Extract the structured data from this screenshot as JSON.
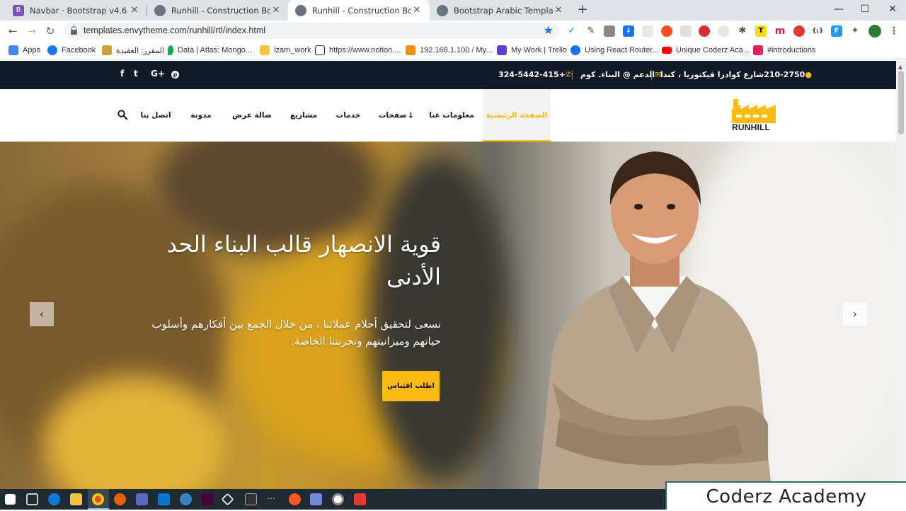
{
  "browser": {
    "tabs": [
      {
        "title": "Navbar · Bootstrap v4.6",
        "icon": "bootstrap-icon",
        "active": false
      },
      {
        "title": "Runhill - Construction Bootstrap",
        "icon": "globe-icon",
        "active": false
      },
      {
        "title": "Runhill - Construction Bootstrap",
        "icon": "globe-icon",
        "active": true
      },
      {
        "title": "Bootstrap Arabic Template",
        "icon": "globe-icon",
        "active": false
      }
    ],
    "new_tab": "+",
    "window_controls": {
      "minimize": "—",
      "maximize": "☐",
      "close": "✕"
    },
    "address": {
      "url": "templates.envytheme.com/runhill/rtl/index.html"
    },
    "bookmarks": [
      {
        "label": "Apps",
        "color": "#4285f4"
      },
      {
        "label": "Facebook",
        "color": "#1877f2"
      },
      {
        "label": "المقرر: العقيدة",
        "color": "#c9a13a"
      },
      {
        "label": "Data | Atlas: Mongo...",
        "color": "#13aa52"
      },
      {
        "label": "izam_work",
        "color": "#f5c542"
      },
      {
        "label": "https://www.notion....",
        "color": "#222222"
      },
      {
        "label": "192.168.1.100 / My...",
        "color": "#f29111"
      },
      {
        "label": "My Work | Trello",
        "color": "#5d3fd3"
      },
      {
        "label": "Using React Router...",
        "color": "#1a73e8"
      },
      {
        "label": "Unique Coderz Aca...",
        "color": "#ff0000"
      },
      {
        "label": "#introductions",
        "color": "#e01e5a"
      }
    ]
  },
  "site": {
    "topbar": {
      "address": "210-2750شارع كوادرا فيكتوريا ، كندا",
      "email": "الدعم @ البناء. كوم",
      "phone": "+324-5442-415",
      "social": [
        "f",
        "t",
        "G+",
        "p"
      ]
    },
    "logo": {
      "text": "RUNHILL"
    },
    "menu": [
      {
        "label": "الصفحة الرئيسية",
        "active": true
      },
      {
        "label": "معلومات عنا",
        "active": false
      },
      {
        "label": "صفحات ⭣",
        "active": false
      },
      {
        "label": "خدمات",
        "active": false
      },
      {
        "label": "مشاريع",
        "active": false
      },
      {
        "label": "صالة عرض",
        "active": false
      },
      {
        "label": "مدونة",
        "active": false
      },
      {
        "label": "اتصل بنا",
        "active": false
      }
    ],
    "hero": {
      "title": "قوية الانصهار قالب البناء الحد الأدنى",
      "subtitle": "نسعى لتحقيق أحلام عملائنا ، من خلال الجمع بين أفكارهم وأسلوب حياتهم وميزانيتهم وتجربتنا الخاصة.",
      "button": "اطلب اقتباس",
      "prev": "‹",
      "next": "›"
    }
  },
  "colors": {
    "accent": "#fbbb10",
    "dark": "#121a26"
  },
  "watermark": "Coderz Academy"
}
